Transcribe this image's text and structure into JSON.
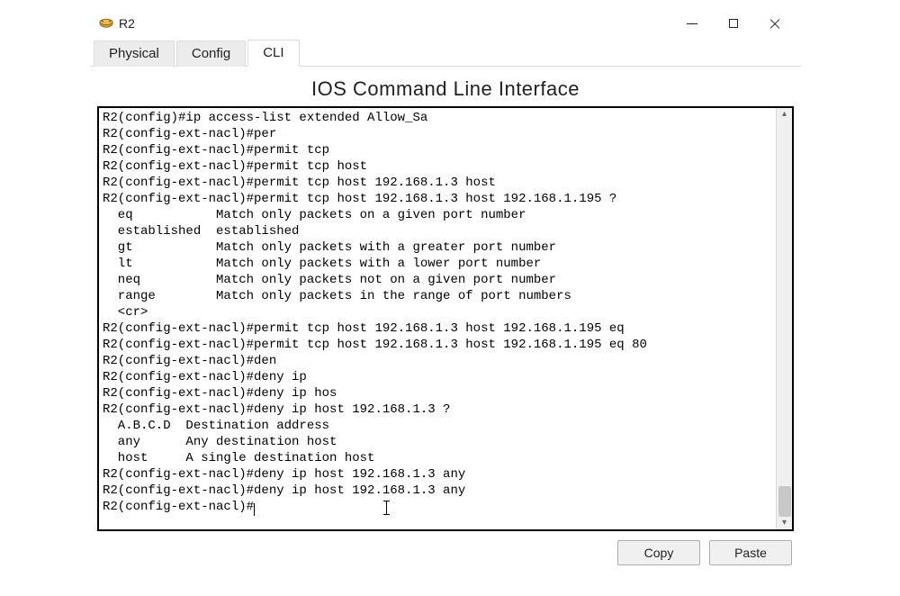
{
  "window": {
    "title": "R2",
    "controls": {
      "minimize": "min",
      "maximize": "max",
      "close": "close"
    }
  },
  "tabs": [
    {
      "label": "Physical",
      "active": false
    },
    {
      "label": "Config",
      "active": false
    },
    {
      "label": "CLI",
      "active": true
    }
  ],
  "pane_title": "IOS Command Line Interface",
  "terminal_lines": [
    "R2(config)#ip access-list extended Allow_Sa",
    "R2(config-ext-nacl)#per",
    "R2(config-ext-nacl)#permit tcp",
    "R2(config-ext-nacl)#permit tcp host",
    "R2(config-ext-nacl)#permit tcp host 192.168.1.3 host",
    "R2(config-ext-nacl)#permit tcp host 192.168.1.3 host 192.168.1.195 ?",
    "  eq           Match only packets on a given port number",
    "  established  established",
    "  gt           Match only packets with a greater port number",
    "  lt           Match only packets with a lower port number",
    "  neq          Match only packets not on a given port number",
    "  range        Match only packets in the range of port numbers",
    "  <cr>",
    "R2(config-ext-nacl)#permit tcp host 192.168.1.3 host 192.168.1.195 eq",
    "R2(config-ext-nacl)#permit tcp host 192.168.1.3 host 192.168.1.195 eq 80",
    "R2(config-ext-nacl)#den",
    "R2(config-ext-nacl)#deny ip",
    "R2(config-ext-nacl)#deny ip hos",
    "R2(config-ext-nacl)#deny ip host 192.168.1.3 ?",
    "  A.B.C.D  Destination address",
    "  any      Any destination host",
    "  host     A single destination host",
    "R2(config-ext-nacl)#deny ip host 192.168.1.3 any",
    "R2(config-ext-nacl)#deny ip host 192.168.1.3 any",
    "R2(config-ext-nacl)#"
  ],
  "buttons": {
    "copy": "Copy",
    "paste": "Paste"
  }
}
